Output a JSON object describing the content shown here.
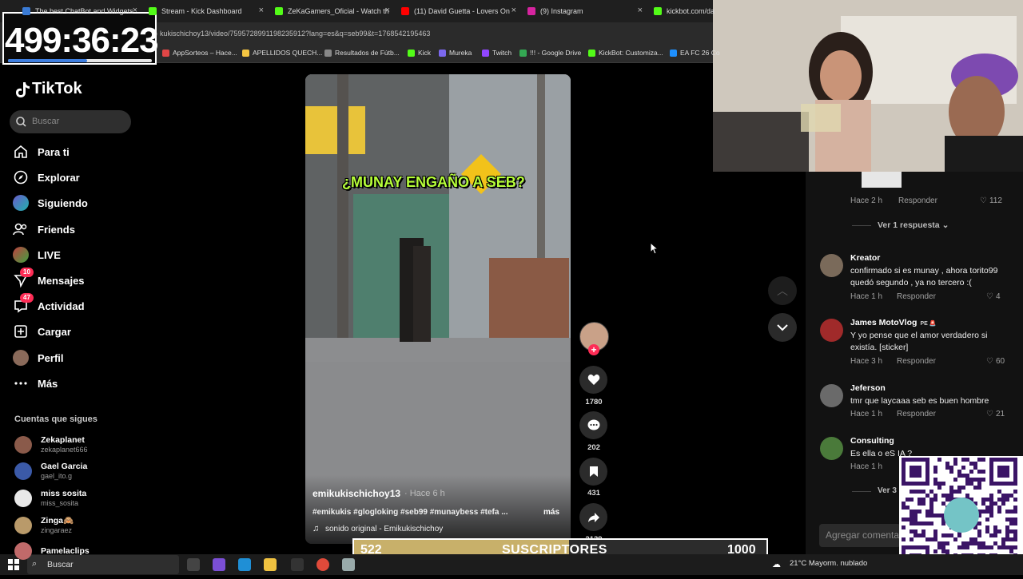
{
  "browser": {
    "tabs": [
      {
        "title": "The best ChatBot and Widgets",
        "color": "#3a7bd5"
      },
      {
        "title": "Stream - Kick Dashboard",
        "color": "#53fc18"
      },
      {
        "title": "ZeKaGamers_Oficial - Watch th",
        "color": "#53fc18"
      },
      {
        "title": "(11) David Guetta - Lovers On",
        "color": "#ff0000"
      },
      {
        "title": "(9) Instagram",
        "color": "#d6249f"
      },
      {
        "title": "kickbot.com/da",
        "color": "#53fc18"
      }
    ],
    "url": "kukischichoy13/video/7595728991198235912?lang=es&q=seb99&t=1768542195463",
    "bookmarks": [
      {
        "label": "AppSorteos – Hace...",
        "color": "#e04646"
      },
      {
        "label": "APELLIDOS QUECH...",
        "color": "#f5c542"
      },
      {
        "label": "Resultados de Fútb...",
        "color": "#888888"
      },
      {
        "label": "Kick",
        "color": "#53fc18"
      },
      {
        "label": "Mureka",
        "color": "#7b68ee"
      },
      {
        "label": "Twitch",
        "color": "#9146ff"
      },
      {
        "label": "!!! - Google Drive",
        "color": "#34a853"
      },
      {
        "label": "KickBot: Customiza...",
        "color": "#53fc18"
      },
      {
        "label": "EA FC 26 Co",
        "color": "#1e90ff"
      }
    ]
  },
  "timer": {
    "text": "499:36:23",
    "progress": 0.55
  },
  "tiktok": {
    "logo": "TikTok",
    "search_placeholder": "Buscar",
    "nav": [
      {
        "label": "Para ti",
        "icon": "home-icon"
      },
      {
        "label": "Explorar",
        "icon": "compass-icon"
      },
      {
        "label": "Siguiendo",
        "icon": "following-avatar-icon"
      },
      {
        "label": "Friends",
        "icon": "friends-icon"
      },
      {
        "label": "LIVE",
        "icon": "live-icon"
      },
      {
        "label": "Mensajes",
        "icon": "messages-icon",
        "badge": "10"
      },
      {
        "label": "Actividad",
        "icon": "activity-icon",
        "badge": "47"
      },
      {
        "label": "Cargar",
        "icon": "upload-icon"
      },
      {
        "label": "Perfil",
        "icon": "profile-icon"
      },
      {
        "label": "Más",
        "icon": "more-icon"
      }
    ],
    "following_title": "Cuentas que sigues",
    "following": [
      {
        "name": "Zekaplanet",
        "handle": "zekaplanet666",
        "color": "#8a5a4a"
      },
      {
        "name": "Gael Garcia",
        "handle": "gael_ito.g",
        "color": "#3b5aa8"
      },
      {
        "name": "miss sosita",
        "handle": "miss_sosita",
        "color": "#e8e8e8"
      },
      {
        "name": "Zinga🙈",
        "handle": "zingaraez",
        "color": "#b99a6a"
      },
      {
        "name": "Pamelaclips",
        "handle": "",
        "color": "#c06a6a"
      }
    ]
  },
  "video": {
    "overlay_title": "¿MUNAY ENGAÑO A SEB?",
    "author": "emikukischichoy13",
    "time": "· Hace 6 h",
    "tags": "#emikukis #glogloking #seb99 #munaybess #tefa ...",
    "more": "más",
    "sound": "sonido original - Emikukischichoy",
    "likes": "1780",
    "comments": "202",
    "saves": "431",
    "shares": "2139"
  },
  "comments": {
    "view_replies": "Ver 1 respuesta",
    "first": {
      "meta": "Hace 2 h",
      "reply": "Responder",
      "likes": "112"
    },
    "items": [
      {
        "name": "Kreator",
        "text": "confirmado si es munay , ahora torito99 quedó segundo , ya no tercero :(",
        "meta": "Hace 1 h",
        "reply": "Responder",
        "likes": "4",
        "color": "#7a6a5a"
      },
      {
        "name": "James MotoVlog",
        "flag": "PE 🚨",
        "text": "Y yo pense que el amor verdadero si existía. [sticker]",
        "meta": "Hace 3 h",
        "reply": "Responder",
        "likes": "60",
        "color": "#a02a2a"
      },
      {
        "name": "Jeferson",
        "text": "tmr que laycaaa seb es buen hombre",
        "meta": "Hace 1 h",
        "reply": "Responder",
        "likes": "21",
        "color": "#6a6a6a"
      },
      {
        "name": "Consulting",
        "text": "Es ella o eS IA ?",
        "meta": "Hace 1 h",
        "reply": "",
        "likes": "",
        "color": "#4a7a3a"
      }
    ],
    "view_more": "Ver 3",
    "add_placeholder": "Agregar comentario..."
  },
  "subscribers": {
    "current": "522",
    "label": "SUSCRIPTORES",
    "goal": "1000",
    "progress": 0.522
  },
  "taskbar": {
    "search": "Buscar",
    "weather": "21°C  Mayorm. nublado"
  }
}
